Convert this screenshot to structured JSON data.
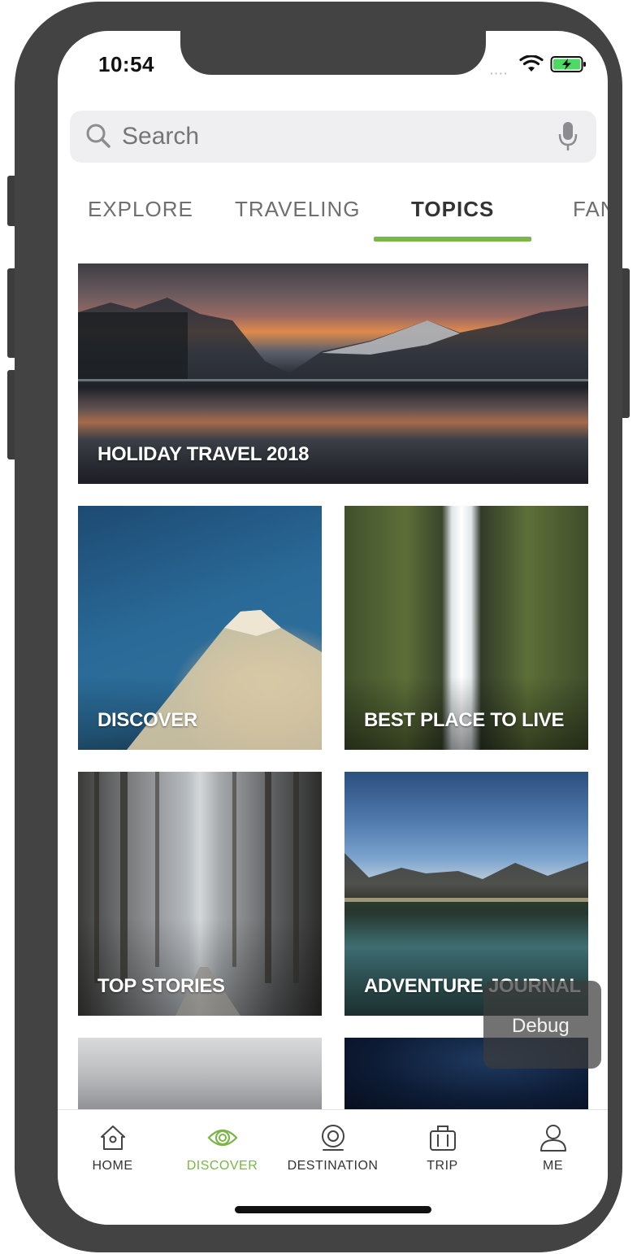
{
  "status_bar": {
    "time": "10:54",
    "signal": "····"
  },
  "search": {
    "placeholder": "Search"
  },
  "tabs": [
    {
      "label": "EXPLORE"
    },
    {
      "label": "TRAVELING"
    },
    {
      "label": "TOPICS",
      "active": true
    },
    {
      "label": "FAN"
    }
  ],
  "topics": [
    {
      "label": "HOLIDAY TRAVEL 2018"
    },
    {
      "label": "DISCOVER"
    },
    {
      "label": "BEST PLACE TO LIVE"
    },
    {
      "label": "TOP STORIES"
    },
    {
      "label": "ADVENTURE JOURNAL"
    }
  ],
  "debug": {
    "label": "Debug"
  },
  "tab_bar": {
    "items": [
      {
        "label": "HOME",
        "icon": "home-icon"
      },
      {
        "label": "DISCOVER",
        "icon": "eye-icon",
        "active": true
      },
      {
        "label": "DESTINATION",
        "icon": "location-icon"
      },
      {
        "label": "TRIP",
        "icon": "suitcase-icon"
      },
      {
        "label": "ME",
        "icon": "user-icon"
      }
    ]
  },
  "colors": {
    "accent": "#7ab648",
    "frame": "#434343",
    "search_bg": "#efeff1"
  }
}
